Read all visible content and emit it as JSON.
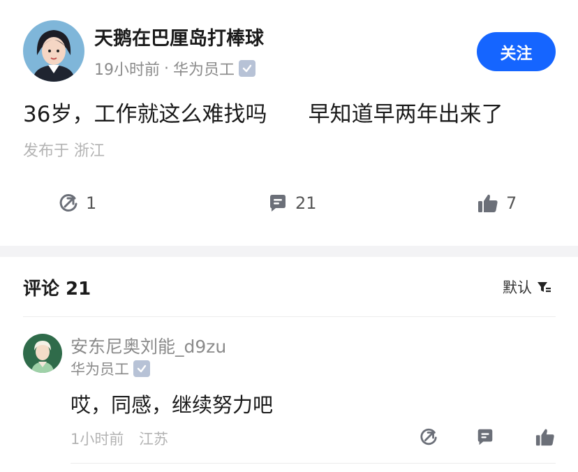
{
  "post": {
    "author": "天鹅在巴厘岛打棒球",
    "time": "19小时前",
    "separator": "·",
    "role": "华为员工",
    "follow_label": "关注",
    "content": "36岁，工作就这么难找吗      早知道早两年出来了",
    "location": "发布于 浙江",
    "repost_count": "1",
    "comment_count": "21",
    "like_count": "7"
  },
  "comments_section": {
    "title": "评论 21",
    "sort_label": "默认"
  },
  "comments": [
    {
      "name": "安东尼奥刘能_d9zu",
      "role": "华为员工",
      "text": "哎，同感，继续努力吧",
      "time": "1小时前",
      "location": "江苏"
    }
  ],
  "colors": {
    "accent": "#1565ff",
    "icon": "#6b6f78",
    "verify_badge": "#b7c2d6"
  }
}
